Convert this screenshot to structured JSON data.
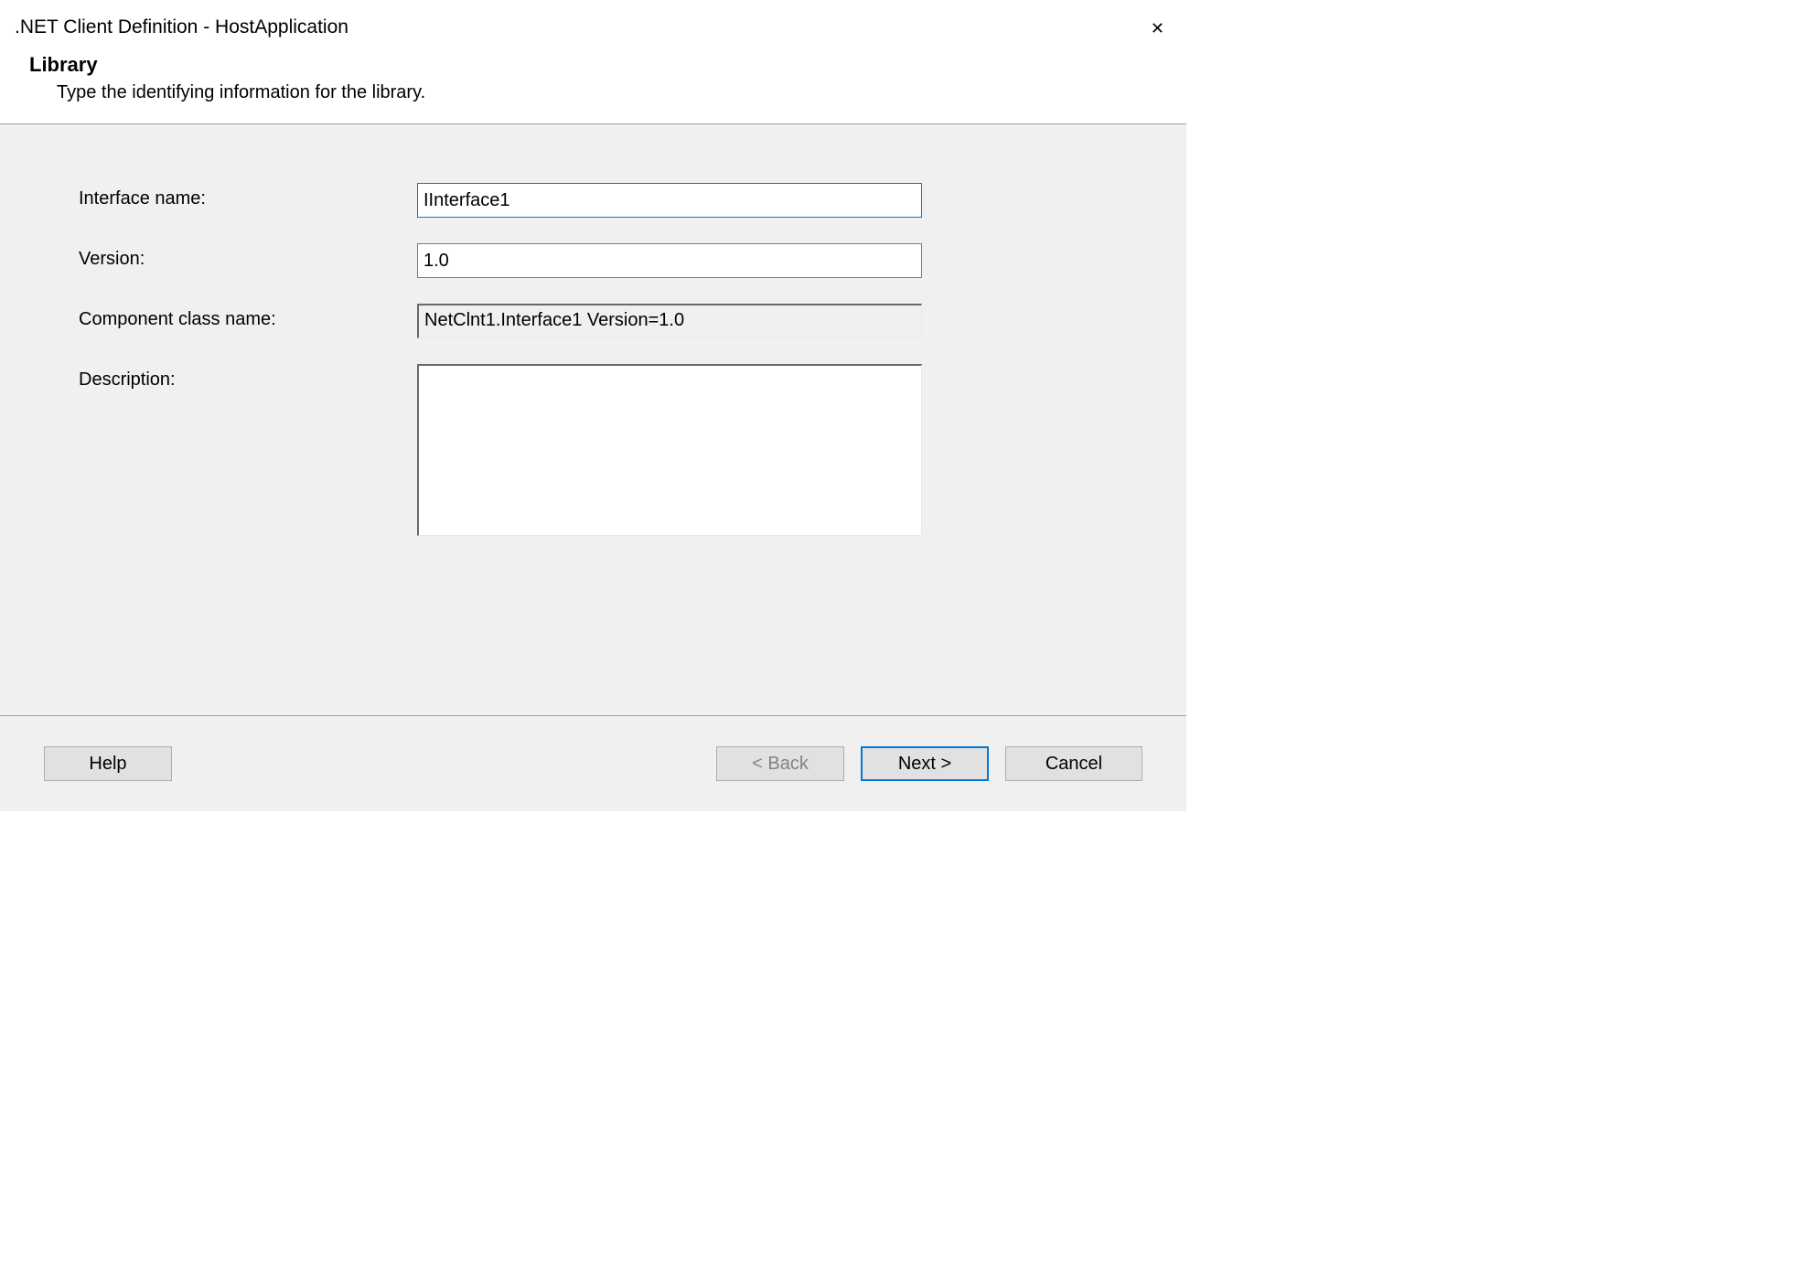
{
  "window": {
    "title": ".NET Client Definition - HostApplication"
  },
  "header": {
    "title": "Library",
    "description": "Type the identifying information for the library."
  },
  "form": {
    "interface_name": {
      "label": "Interface name:",
      "value": "IInterface1"
    },
    "version": {
      "label": "Version:",
      "value": "1.0"
    },
    "component_class_name": {
      "label": "Component class name:",
      "value": "NetClnt1.Interface1 Version=1.0"
    },
    "description": {
      "label": "Description:",
      "value": ""
    }
  },
  "buttons": {
    "help": "Help",
    "back": "< Back",
    "next": "Next >",
    "cancel": "Cancel"
  }
}
